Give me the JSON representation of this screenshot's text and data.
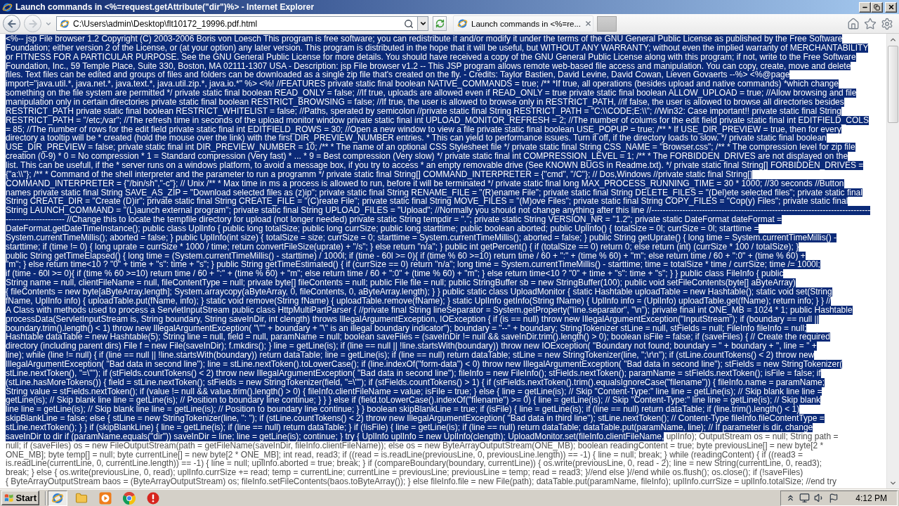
{
  "window": {
    "title": "Launch commands in <%=request.getAttribute(\"dir\")%> - Internet Explorer"
  },
  "navigation": [
    {
      "kind": "back",
      "disabled": false
    },
    {
      "kind": "forward",
      "disabled": true
    }
  ],
  "address_bar": {
    "value": "C:\\Users\\admin\\Desktop\\flt10172_19996.pdf.html"
  },
  "tabs": [
    {
      "label": "Launch commands in <%=re...",
      "selected": true
    }
  ],
  "page": {
    "lines": [
      {
        "segments": [
          {
            "text": "<%-- jsp File browser 1.2 Copyright (C) 2003-2006 Boris von Loesch This program is free software; you can redistribute it and/or modify it under the terms of the GNU General Public License as published by the Free Software",
            "selected": true
          }
        ]
      },
      {
        "segments": [
          {
            "text": "Foundation; either version 2 of the License, or (at your option) any later version. This program is distributed in the hope that it will be useful, but WITHOUT ANY WARRANTY; without even the implied warranty of MERCHANTABILITY",
            "selected": true
          }
        ]
      },
      {
        "segments": [
          {
            "text": "or FITNESS FOR A PARTICULAR PURPOSE. See the GNU General Public License for more details. You should have received a copy of the GNU General Public License along with this program; if not, write to the Free Software",
            "selected": true
          }
        ]
      },
      {
        "segments": [
          {
            "text": "Foundation, Inc., 59 Temple Place, Suite 330, Boston, MA 02111-1307 USA - Description: jsp File browser v1.2 -- This JSP program allows remote web-based file access and manipulation. You can copy, create, move and delete",
            "selected": true
          }
        ]
      },
      {
        "segments": [
          {
            "text": "files. Text files can be edited and groups of files and folders can be downloaded as a single zip file that's created on the fly. - Credits: Taylor Bastien, David Levine, David Cowan, Lieven Govaerts --%> <%@page",
            "selected": true
          }
        ]
      },
      {
        "segments": [
          {
            "text": "import=\"java.util.*, java.net.*, java.text.*, java.util.zip.*, java.io.*\" %> <%! //FEATURES private static final boolean NATIVE_COMMANDS = true; /** *If true, all operations (besides upload and native commands) *which change",
            "selected": true
          }
        ]
      },
      {
        "segments": [
          {
            "text": "something on the file system are permitted */ private static final boolean READ_ONLY = false; //If true, uploads are allowed even if READ_ONLY = true private static final boolean ALLOW_UPLOAD = true; //Allow browsing and file",
            "selected": true
          }
        ]
      },
      {
        "segments": [
          {
            "text": "manipulation only in certain directories private static final boolean RESTRICT_BROWSING = false; //If true, the user is allowed to browse only in RESTRICT_PATH, //if false, the user is allowed to browse all directories besides",
            "selected": true
          }
        ]
      },
      {
        "segments": [
          {
            "text": "RESTRICT_PATH private static final boolean RESTRICT_WHITELIST = false; //Paths, sperated by semicolon //private static final String RESTRICT_PATH = \"C:\\\\CODE;E:\\\\\"; //Win32: Case important!! private static final String",
            "selected": true
          }
        ]
      },
      {
        "segments": [
          {
            "text": "RESTRICT_PATH = \"/etc;/var\"; //The refresh time in seconds of the upload monitor window private static final int UPLOAD_MONITOR_REFRESH = 2; //The number of colums for the edit field private static final int EDITFIELD_COLS",
            "selected": true
          }
        ]
      },
      {
        "segments": [
          {
            "text": "= 85; //The number of rows for the edit field private static final int EDITFIELD_ROWS = 30; //Open a new window to view a file private static final boolean USE_POPUP = true; /** * If USE_DIR_PREVIEW = true, then for every",
            "selected": true
          }
        ]
      },
      {
        "segments": [
          {
            "text": "directory a tooltip will be * created (hold the mouse over the link) with the first DIR_PREVIEW_NUMBER entries. * This can yield to performance issues. Turn it off, if the directory loads to slow. */ private static final boolean",
            "selected": true
          }
        ]
      },
      {
        "segments": [
          {
            "text": "USE_DIR_PREVIEW = false; private static final int DIR_PREVIEW_NUMBER = 10; /** * The name of an optional CSS Stylesheet file */ private static final String CSS_NAME = \"Browser.css\"; /** * The compression level for zip file",
            "selected": true
          }
        ]
      },
      {
        "segments": [
          {
            "text": "creation (0-9) * 0 = No compression * 1 = Standard compression (Very fast) * ... * 9 = Best compression (Very slow) */ private static final int COMPRESSION_LEVEL = 1; /** * The FORBIDDEN_DRIVES are not displayed on the",
            "selected": true
          }
        ]
      },
      {
        "segments": [
          {
            "text": "list. This can be usefull, if the * server runs on a windows platform, to avoid a message box, if you try to access * an empty removable drive (See KNOWN BUGS in Readme.txt). */ private static final String[] FORBIDDEN_DRIVES =",
            "selected": true
          }
        ]
      },
      {
        "segments": [
          {
            "text": "{\"a:\\\\\"}; /** * Command of the shell interpreter and the parameter to run a programm */ private static final String[] COMMAND_INTERPRETER = {\"cmd\", \"/C\"}; // Dos,Windows //private static final String[]",
            "selected": true
          }
        ]
      },
      {
        "segments": [
          {
            "text": "COMMAND_INTERPRETER = {\"/bin/sh\",\"-c\"}; // Unix /** * Max time in ms a process is allowed to run, before it will be terminated */ private static final long MAX_PROCESS_RUNNING_TIME = 30 * 1000; //30 seconds //Button",
            "selected": true
          }
        ]
      },
      {
        "segments": [
          {
            "text": "names private static final String SAVE_AS_ZIP = \"Download selected files as (z)ip\"; private static final String RENAME_FILE = \"(R)ename File\"; private static final String DELETE_FILES = \"(Del)ete selected files\"; private static final",
            "selected": true
          }
        ]
      },
      {
        "segments": [
          {
            "text": "String CREATE_DIR = \"Create (D)ir\"; private static final String CREATE_FILE = \"(C)reate File\"; private static final String MOVE_FILES = \"(M)ove Files\"; private static final String COPY_FILES = \"Cop(y) Files\"; private static final",
            "selected": true
          }
        ]
      },
      {
        "segments": [
          {
            "text": "String LAUNCH_COMMAND = \"(L)aunch external program\"; private static final String UPLOAD_FILES = \"Upload\"; //Normally you should not change anything after this line //------------------------------------------------------------------------------",
            "selected": true
          }
        ]
      },
      {
        "segments": [
          {
            "text": "--------------------- //Change this to locate the tempfile directory for upload (not longer needed) private static String tempdir = \".\"; private static String VERSION_NR = \"1.2\"; private static DateFormat dateFormat =",
            "selected": true
          }
        ]
      },
      {
        "segments": [
          {
            "text": "DateFormat.getDateTimeInstance(); public class UplInfo { public long totalSize; public long currSize; public long starttime; public boolean aborted; public UplInfo() { totalSize = 0l; currSize = 0l; starttime =",
            "selected": true
          }
        ]
      },
      {
        "segments": [
          {
            "text": "System.currentTimeMillis(); aborted = false; } public UplInfo(int size) { totalSize = size; currSize = 0; starttime = System.currentTimeMillis(); aborted = false; } public String getUprate() { long time = System.currentTimeMillis() -",
            "selected": true
          }
        ]
      },
      {
        "segments": [
          {
            "text": "starttime; if (time != 0) { long uprate = currSize * 1000 / time; return convertFileSize(uprate) + \"/s\"; } else return \"n/a\"; } public int getPercent() { if (totalSize == 0) return 0; else return (int) (currSize * 100 / totalSize); }",
            "selected": true
          }
        ]
      },
      {
        "segments": [
          {
            "text": "public String getTimeElapsed() { long time = (System.currentTimeMillis() - starttime) / 1000l; if (time - 60l >= 0){ if (time % 60 >=10) return time / 60 + \":\" + (time % 60) + \"m\"; else return time / 60 + \":0\" + (time % 60) +",
            "selected": true
          }
        ]
      },
      {
        "segments": [
          {
            "text": "\"m\"; } else return time<10 ? \"0\" + time + \"s\": time + \"s\"; } public String getTimeEstimated() { if (currSize == 0) return \"n/a\"; long time = System.currentTimeMillis() - starttime; time = totalSize * time / currSize; time /= 1000l;",
            "selected": true
          }
        ]
      },
      {
        "segments": [
          {
            "text": "if (time - 60l >= 0){ if (time % 60 >=10) return time / 60 + \":\" + (time % 60) + \"m\"; else return time / 60 + \":0\" + (time % 60) + \"m\"; } else return time<10 ? \"0\" + time + \"s\": time + \"s\"; } } public class FileInfo { public",
            "selected": true
          }
        ]
      },
      {
        "segments": [
          {
            "text": "String name = null, clientFileName = null, fileContentType = null; private byte[] fileContents = null; public File file = null; public StringBuffer sb = new StringBuffer(100); public void setFileContents(byte[] aByteArray)",
            "selected": true
          }
        ]
      },
      {
        "segments": [
          {
            "text": "{ fileContents = new byte[aByteArray.length]; System.arraycopy(aByteArray, 0, fileContents, 0, aByteArray.length); } } public static class UploadMonitor { static Hashtable uploadTable = new Hashtable(); static void set(String",
            "selected": true
          }
        ]
      },
      {
        "segments": [
          {
            "text": "fName, UplInfo info) { uploadTable.put(fName, info); } static void remove(String fName) { uploadTable.remove(fName); } static UplInfo getInfo(String fName) { UplInfo info = (UplInfo) uploadTable.get(fName); return info; } } //",
            "selected": true
          }
        ]
      },
      {
        "segments": [
          {
            "text": "A Class with methods used to process a ServletInputStream public class HttpMultiPartParser { //private final String lineSeparator = System.getProperty(\"line.separator\", \"\\n\"); private final int ONE_MB = 1024 * 1; public Hashtable",
            "selected": true
          }
        ]
      },
      {
        "segments": [
          {
            "text": "processData(ServletInputStream is, String boundary, String saveInDir, int clength) throws IllegalArgumentException, IOException { if (is == null) throw new IllegalArgumentException(\"InputStream\"); if (boundary == null ||",
            "selected": true
          }
        ]
      },
      {
        "segments": [
          {
            "text": "boundary.trim().length() < 1) throw new IllegalArgumentException( \"\\\"\" + boundary + \"\\\" is an illegal boundary indicator\"); boundary = \"--\" + boundary; StringTokenizer stLine = null, stFields = null; FileInfo fileInfo = null;",
            "selected": true
          }
        ]
      },
      {
        "segments": [
          {
            "text": "Hashtable dataTable = new Hashtable(5); String line = null, field = null, paramName = null; boolean saveFiles = (saveInDir != null && saveInDir.trim().length() > 0); boolean isFile = false; if (saveFiles) { // Create the required",
            "selected": true
          }
        ]
      },
      {
        "segments": [
          {
            "text": "directory (including parent dirs) File f = new File(saveInDir); f.mkdirs(); } line = getLine(is); if (line == null || !line.startsWith(boundary)) throw new IOException( \"Boundary not found; boundary = \" + boundary + \", line = \" +",
            "selected": true
          }
        ]
      },
      {
        "segments": [
          {
            "text": "line); while (line != null) { if (line == null || !line.startsWith(boundary)) return dataTable; line = getLine(is); if (line == null) return dataTable; stLine = new StringTokenizer(line, \";\\r\\n\"); if (stLine.countTokens() < 2) throw new",
            "selected": true
          }
        ]
      },
      {
        "segments": [
          {
            "text": "IllegalArgumentException( \"Bad data in second line\"); line = stLine.nextToken().toLowerCase(); if (line.indexOf(\"form-data\") < 0) throw new IllegalArgumentException( \"Bad data in second line\"); stFields = new StringTokenizer(",
            "selected": true
          }
        ]
      },
      {
        "segments": [
          {
            "text": "stLine.nextToken(), \"=\\\"\"); if (stFields.countTokens() < 2) throw new IllegalArgumentException( \"Bad data in second line\"); fileInfo = new FileInfo(); stFields.nextToken(); paramName = stFields.nextToken(); isFile = false; if",
            "selected": true
          }
        ]
      },
      {
        "segments": [
          {
            "text": "(stLine.hasMoreTokens()) { field = stLine.nextToken(); stFields = new StringTokenizer(field, \"=\\\"\"); if (stFields.countTokens() > 1) { if (stFields.nextToken().trim().equalsIgnoreCase(\"filename\")) { fileInfo.name = paramName;",
            "selected": true
          }
        ]
      },
      {
        "segments": [
          {
            "text": "String value = stFields.nextToken(); if (value != null && value.trim().length() > 0) { fileInfo.clientFileName = value; isFile = true; } else { line = getLine(is); // Skip \"Content-Type:\" line line = getLine(is); // Skip blank line line =",
            "selected": true
          }
        ]
      },
      {
        "segments": [
          {
            "text": "getLine(is); // Skip blank line line = getLine(is); // Position to boundary line continue; } } } else if (field.toLowerCase().indexOf(\"filename\") >= 0) { line = getLine(is); // Skip \"Content-Type:\" line line = getLine(is); // Skip blank",
            "selected": true
          }
        ]
      },
      {
        "segments": [
          {
            "text": "line line = getLine(is); // Skip blank line line = getLine(is); // Position to boundary line continue; } } boolean skipBlankLine = true; if (isFile) { line = getLine(is); if (line == null) return dataTable; if (line.trim().length() < 1)",
            "selected": true
          }
        ]
      },
      {
        "segments": [
          {
            "text": "skipBlankLine = false; else { stLine = new StringTokenizer(line, \": \"); if (stLine.countTokens() < 2) throw new IllegalArgumentException( \"Bad data in third line\"); stLine.nextToken(); // Content-Type fileInfo.fileContentType =",
            "selected": true
          }
        ]
      },
      {
        "segments": [
          {
            "text": "stLine.nextToken(); } } if (skipBlankLine) { line = getLine(is); if (line == null) return dataTable; } if (!isFile) { line = getLine(is); if (line == null) return dataTable; dataTable.put(paramName, line); // If parameter is dir, change",
            "selected": true
          }
        ]
      },
      {
        "segments": [
          {
            "text": "saveInDir to dir if (paramName.equals(\"dir\")) saveInDir = line; line = getLine(is); continue; } try { UplInfo uplInfo = new UplInfo(clength); UploadMonitor.set(fileInfo.clientFileName,",
            "selected": true
          },
          {
            "text": " uplInfo); OutputStream os = null; String path =",
            "selected": false
          }
        ]
      },
      {
        "segments": [
          {
            "text": "null; if (saveFiles) os = new FileOutputStream(path = getFileName(saveInDir, fileInfo.clientFileName)); else os = new ByteArrayOutputStream(ONE_MB); boolean readingContent = true; byte previousLine[] = new byte[2 *",
            "selected": false
          }
        ]
      },
      {
        "segments": [
          {
            "text": "ONE_MB]; byte temp[] = null; byte currentLine[] = new byte[2 * ONE_MB]; int read, read3; if ((read = is.readLine(previousLine, 0, previousLine.length)) == -1) { line = null; break; } while (readingContent) { if ((read3 =",
            "selected": false
          }
        ]
      },
      {
        "segments": [
          {
            "text": "is.readLine(currentLine, 0, currentLine.length)) == -1) { line = null; uplInfo.aborted = true; break; } if (compareBoundary(boundary, currentLine)) { os.write(previousLine, 0, read - 2); line = new String(currentLine, 0, read3);",
            "selected": false
          }
        ]
      },
      {
        "segments": [
          {
            "text": "break; } else { os.write(previousLine, 0, read); uplInfo.currSize += read; temp = currentLine; currentLine = previousLine; previousLine = temp; read = read3; }//end else }//end while os.flush(); os.close(); if (!saveFiles)",
            "selected": false
          }
        ]
      },
      {
        "segments": [
          {
            "text": "{ ByteArrayOutputStream baos = (ByteArrayOutputStream) os; fileInfo.setFileContents(baos.toByteArray()); } else fileInfo.file = new File(path); dataTable.put(paramName, fileInfo); uplInfo.currSize = uplInfo.totalSize; //end try",
            "selected": false
          }
        ]
      }
    ]
  },
  "taskbar": {
    "start_label": "Start",
    "quick_launch": [
      {
        "kind": "ring",
        "pressed": true
      },
      {
        "kind": "folder",
        "pressed": false
      },
      {
        "kind": "play",
        "pressed": false
      },
      {
        "kind": "segmented",
        "pressed": false
      },
      {
        "kind": "alert",
        "pressed": false
      }
    ],
    "clock": "4:12 PM"
  }
}
